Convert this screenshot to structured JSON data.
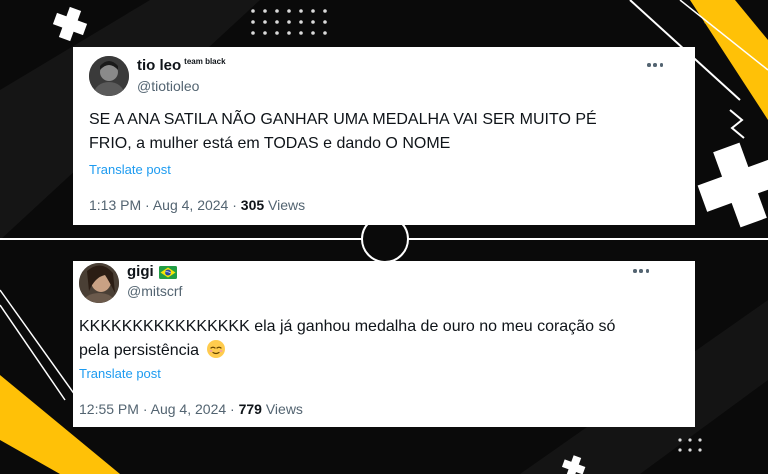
{
  "colors": {
    "background": "#0a0a0a",
    "accent_yellow": "#ffc107",
    "link_blue": "#1d9bf0",
    "text_primary": "#0f1419",
    "text_secondary": "#536471"
  },
  "tweets": [
    {
      "display_name": "tio leo",
      "name_badge": "team black",
      "handle": "@tiotioleo",
      "text_line1": "SE A ANA SATILA NÃO GANHAR UMA MEDALHA VAI SER MUITO PÉ",
      "text_line2": "FRIO, a mulher está em TODAS e dando O NOME",
      "translate_label": "Translate post",
      "time": "1:13 PM",
      "date": "Aug 4, 2024",
      "views_count": "305",
      "views_label": "Views"
    },
    {
      "display_name": "gigi",
      "flag_icon": "brazil-flag-icon",
      "handle": "@mitscrf",
      "text_line1": "KKKKKKKKKKKKKKKK ela já ganhou medalha de ouro no meu coração só",
      "text_line2": "pela persistência",
      "emoji_icon": "relieved-face-emoji",
      "translate_label": "Translate post",
      "time": "12:55 PM",
      "date": "Aug 4, 2024",
      "views_count": "779",
      "views_label": "Views"
    }
  ],
  "separator": "·"
}
